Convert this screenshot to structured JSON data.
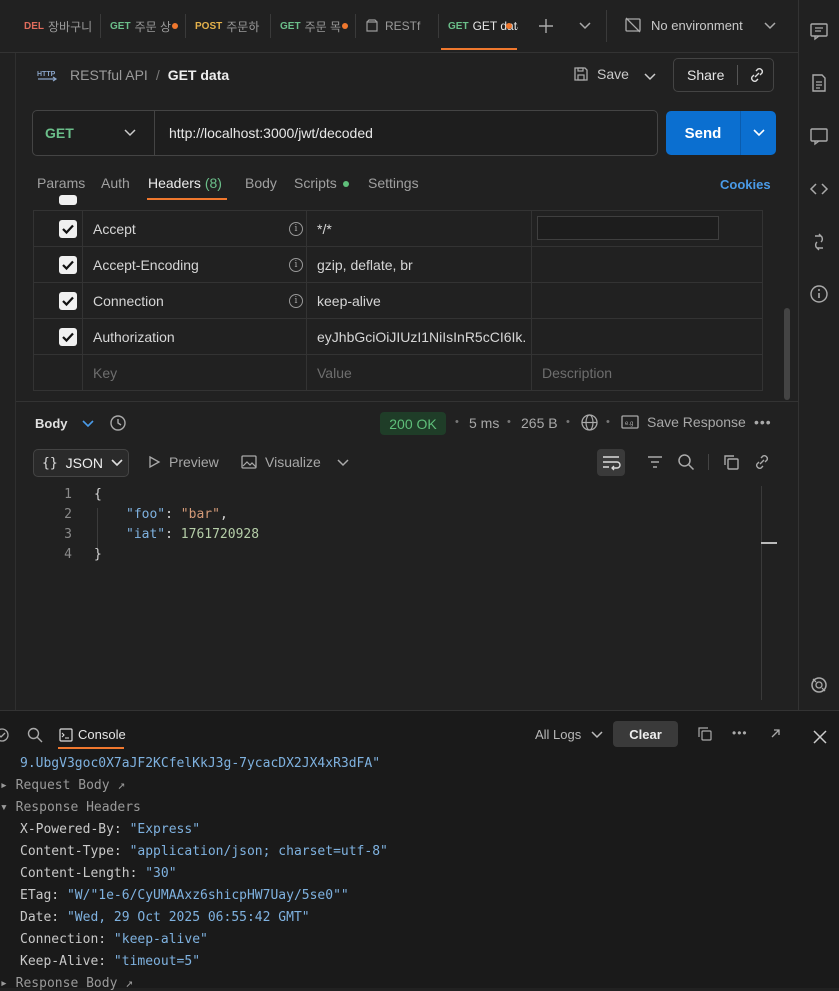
{
  "tabs": [
    {
      "method": "DEL",
      "method_color": "#e06c5c",
      "label": "장바구니",
      "unsaved": false
    },
    {
      "method": "GET",
      "method_color": "#6bbf8a",
      "label": "주문 상",
      "unsaved": true
    },
    {
      "method": "POST",
      "method_color": "#e5b24b",
      "label": "주문하",
      "unsaved": false
    },
    {
      "method": "GET",
      "method_color": "#6bbf8a",
      "label": "주문 목",
      "unsaved": false
    },
    {
      "method": "",
      "method_color": "",
      "label": "RESTf",
      "unsaved": false
    },
    {
      "method": "GET",
      "method_color": "#6bbf8a",
      "label": "GET data",
      "unsaved": true
    }
  ],
  "environment": "No environment",
  "breadcrumb": {
    "collection": "RESTful API",
    "separator": "/",
    "request": "GET data"
  },
  "http_badge": "HTTP",
  "actions": {
    "save": "Save",
    "share": "Share"
  },
  "request": {
    "method": "GET",
    "url": "http://localhost:3000/jwt/decoded",
    "send": "Send"
  },
  "subtabs": {
    "params": "Params",
    "auth": "Auth",
    "headers": "Headers",
    "headers_count": "(8)",
    "body": "Body",
    "scripts": "Scripts",
    "settings": "Settings",
    "cookies": "Cookies"
  },
  "headers": [
    {
      "key": "Accept",
      "value": "*/*",
      "checked": true
    },
    {
      "key": "Accept-Encoding",
      "value": "gzip, deflate, br",
      "checked": true
    },
    {
      "key": "Connection",
      "value": "keep-alive",
      "checked": true
    },
    {
      "key": "Authorization",
      "value": "eyJhbGciOiJIUzI1NiIsInR5cCI6Ik...",
      "checked": true
    }
  ],
  "headers_placeholder": {
    "key": "Key",
    "value": "Value",
    "description": "Description"
  },
  "response": {
    "body_label": "Body",
    "status": "200 OK",
    "time": "5 ms",
    "size": "265 B",
    "save_response": "Save Response",
    "format": "JSON",
    "preview": "Preview",
    "visualize": "Visualize"
  },
  "code": {
    "line_numbers": [
      "1",
      "2",
      "3",
      "4"
    ],
    "open": "{",
    "close": "}",
    "k1": "\"foo\"",
    "v1": "\"bar\"",
    "k2": "\"iat\"",
    "v2": "1761720928"
  },
  "console": {
    "tab": "Console",
    "filter": "All Logs",
    "clear": "Clear",
    "token_tail": "9.UbgV3goc0X7aJF2KCfelKkJ3g-7ycacDX2JX4xR3dFA\"",
    "request_body": "Request Body",
    "response_headers": "Response Headers",
    "headers": [
      {
        "k": "X-Powered-By:",
        "v": "\"Express\""
      },
      {
        "k": "Content-Type:",
        "v": "\"application/json; charset=utf-8\""
      },
      {
        "k": "Content-Length:",
        "v": "\"30\""
      },
      {
        "k": "ETag:",
        "v": "\"W/\"1e-6/CyUMAAxz6shicpHW7Uay/5se0\"\""
      },
      {
        "k": "Date:",
        "v": "\"Wed, 29 Oct 2025 06:55:42 GMT\""
      },
      {
        "k": "Connection:",
        "v": "\"keep-alive\""
      },
      {
        "k": "Keep-Alive:",
        "v": "\"timeout=5\""
      }
    ],
    "response_body": "Response Body"
  },
  "colors": {
    "accent": "#0b6fd0",
    "status_ok": "#5fbf7a",
    "tab_dot": "#f0782e"
  }
}
